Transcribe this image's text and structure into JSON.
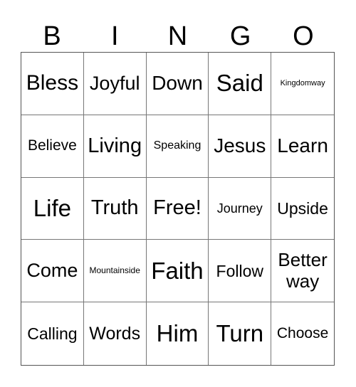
{
  "header": {
    "letters": [
      "B",
      "I",
      "N",
      "G",
      "O"
    ]
  },
  "board": {
    "rows": [
      [
        "Bless",
        "Joyful",
        "Down",
        "Said",
        "Kingdomway"
      ],
      [
        "Believe",
        "Living",
        "Speaking",
        "Jesus",
        "Learn"
      ],
      [
        "Life",
        "Truth",
        "Free!",
        "Journey",
        "Upside"
      ],
      [
        "Come",
        "Mountainside",
        "Faith",
        "Follow",
        "Better way"
      ],
      [
        "Calling",
        "Words",
        "Him",
        "Turn",
        "Choose"
      ]
    ]
  }
}
